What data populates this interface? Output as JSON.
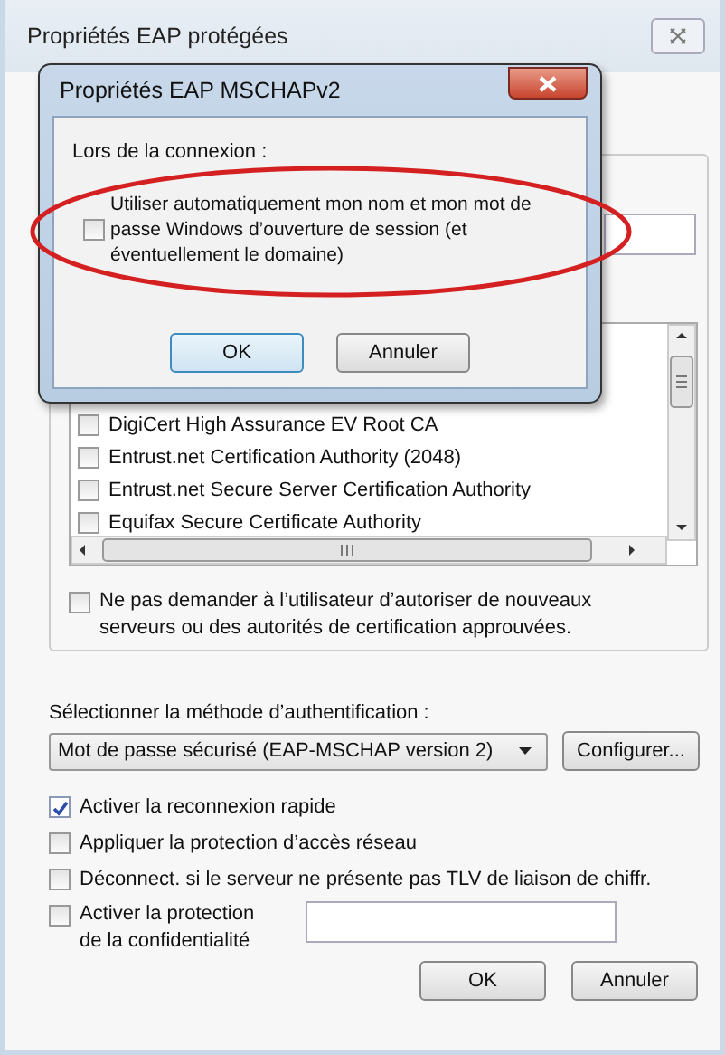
{
  "window": {
    "title": "Propriétés EAP protégées"
  },
  "dialog": {
    "title": "Propriétés EAP MSCHAPv2",
    "label": "Lors de la connexion :",
    "option": {
      "label": "Utiliser automatiquement mon nom et mon mot de passe Windows d’ouverture de session (et éventuellement le domaine)",
      "checked": false
    },
    "buttons": [
      "OK",
      "Annuler"
    ]
  },
  "certificates": [
    {
      "label": "DigiCert High Assurance EV Root CA",
      "checked": false
    },
    {
      "label": "Entrust.net Certification Authority (2048)",
      "checked": false
    },
    {
      "label": "Entrust.net Secure Server Certification Authority",
      "checked": false
    },
    {
      "label": "Equifax Secure Certificate Authority",
      "checked": false
    }
  ],
  "no_prompt": {
    "label": "Ne pas demander à l’utilisateur d’autoriser de nouveaux serveurs ou des autorités de certification approuvées.",
    "checked": false
  },
  "auth": {
    "label": "Sélectionner la méthode d’authentification :",
    "method": "Mot de passe sécurisé (EAP-MSCHAP version 2)",
    "configure": "Configurer..."
  },
  "options": [
    {
      "label": "Activer la reconnexion rapide",
      "checked": true
    },
    {
      "label": "Appliquer la protection d’accès réseau",
      "checked": false
    },
    {
      "label": "Déconnect. si le serveur ne présente pas TLV de liaison de chiffr.",
      "checked": false
    },
    {
      "label": "Activer la protection de la confidentialité",
      "checked": false,
      "kind": "with-field"
    }
  ],
  "buttons": [
    "OK",
    "Annuler"
  ]
}
